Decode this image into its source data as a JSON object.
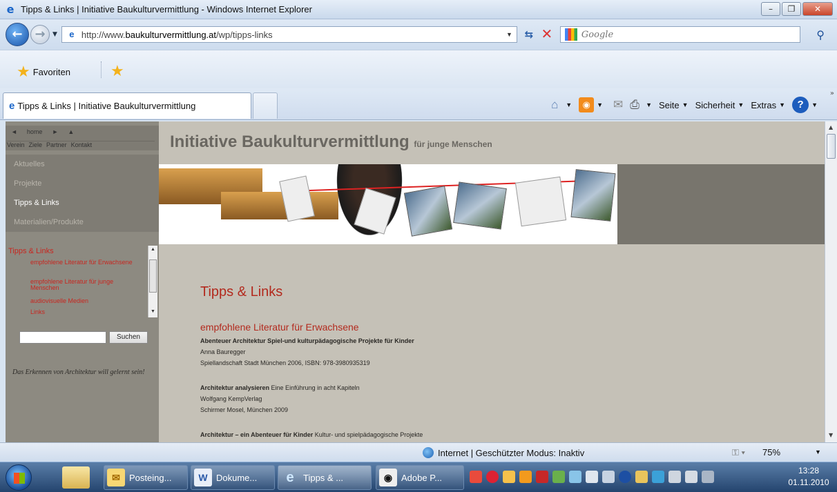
{
  "window": {
    "title": "Tipps & Links | Initiative Baukulturvermittlung - Windows Internet Explorer"
  },
  "address": {
    "prefix": "http://www.",
    "domain": "baukulturvermittlung.at",
    "path": "/wp/tipps-links"
  },
  "search": {
    "placeholder": "Google"
  },
  "favorites": {
    "label": "Favoriten"
  },
  "tab": {
    "label": "Tipps & Links | Initiative Baukulturvermittlung"
  },
  "commandbar": {
    "page": "Seite",
    "safety": "Sicherheit",
    "tools": "Extras"
  },
  "site": {
    "topnav_arrows": [
      "◄",
      "home",
      "►",
      "▲"
    ],
    "topnav_links": [
      "Verein",
      "Ziele",
      "Partner",
      "Kontakt"
    ],
    "nav": [
      {
        "label": "Aktuelles",
        "active": false
      },
      {
        "label": "Projekte",
        "active": false
      },
      {
        "label": "Tipps & Links",
        "active": true
      },
      {
        "label": "Materialien/Produkte",
        "active": false
      }
    ],
    "submenu": {
      "title": "Tipps & Links",
      "links": [
        "empfohlene Literatur für Erwachsene",
        "empfohlene Literatur für junge Menschen",
        "audiovisuelle Medien",
        "Links"
      ]
    },
    "search_button": "Suchen",
    "motto": "Das Erkennen von Architektur will gelernt sein!",
    "header_title": "Initiative Baukulturvermittlung",
    "header_sub": "für junge Menschen",
    "page_title": "Tipps & Links",
    "section_title": "empfohlene Literatur für Erwachsene",
    "entries": [
      {
        "bold": "Abenteuer Architektur Spiel-und kulturpädagogische Projekte für Kinder",
        "rest": "",
        "lines": [
          "Anna Bauregger",
          "Spiellandschaft Stadt München 2006, ISBN: 978-3980935319"
        ]
      },
      {
        "bold": "Architektur analysieren",
        "rest": " Eine Einführung in acht Kapiteln",
        "lines": [
          "Wolfgang KempVerlag",
          "Schirmer Mosel, München 2009"
        ]
      },
      {
        "bold": "Architektur – ein Abenteuer für Kinder",
        "rest": " Kultur- und spielpädagogische Projekte",
        "lines": []
      }
    ]
  },
  "status": {
    "zone": "Internet | Geschützter Modus: Inaktiv",
    "zoom": "75%"
  },
  "taskbar": {
    "buttons": [
      "Posteing...",
      "Dokume...",
      "Tipps & ...",
      "Adobe P..."
    ],
    "time": "13:28",
    "date": "01.11.2010"
  }
}
